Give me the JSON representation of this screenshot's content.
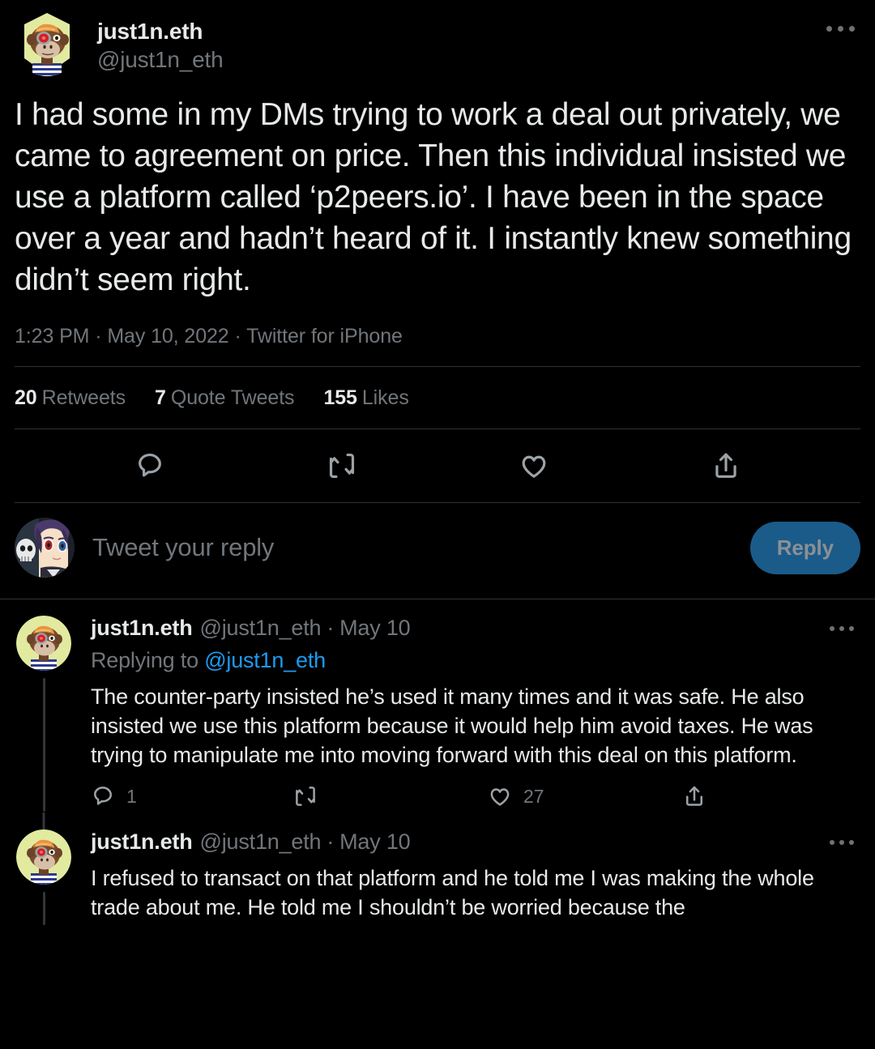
{
  "main_tweet": {
    "display_name": "just1n.eth",
    "handle": "@just1n_eth",
    "body": "I had some in my DMs trying to work a deal out privately, we came to agreement on price. Then this individual insisted we use a platform called ‘p2peers.io’. I have been in the space over a year and hadn’t heard of it. I instantly knew something didn’t seem right.",
    "time": "1:23 PM",
    "date": "May 10, 2022",
    "source": "Twitter for iPhone",
    "meta_line": "1:23 PM · May 10, 2022 · Twitter for iPhone",
    "more_label": "More",
    "stats": [
      {
        "count": "20",
        "label": "Retweets"
      },
      {
        "count": "7",
        "label": "Quote Tweets"
      },
      {
        "count": "155",
        "label": "Likes"
      }
    ],
    "actions": [
      {
        "icon": "reply-icon",
        "label": "Reply"
      },
      {
        "icon": "retweet-icon",
        "label": "Retweet"
      },
      {
        "icon": "like-icon",
        "label": "Like"
      },
      {
        "icon": "share-icon",
        "label": "Share"
      }
    ]
  },
  "composer": {
    "placeholder": "Tweet your reply",
    "button_label": "Reply",
    "button_color": "#1a5b8a",
    "button_text_color": "#8c9095"
  },
  "replies": [
    {
      "display_name": "just1n.eth",
      "handle": "@just1n_eth",
      "separator": "·",
      "date": "May 10",
      "replying_to_prefix": "Replying to ",
      "replying_to_handle": "@just1n_eth",
      "body": "The counter-party insisted he’s used it many times and it was safe. He also insisted we use this platform because it would help him avoid taxes. He was trying to manipulate me into moving forward with this deal on this platform.",
      "actions": [
        {
          "icon": "reply-icon",
          "count": "1"
        },
        {
          "icon": "retweet-icon",
          "count": ""
        },
        {
          "icon": "like-icon",
          "count": "27"
        },
        {
          "icon": "share-icon",
          "count": ""
        }
      ],
      "has_replying_to": true,
      "more_label": "More"
    },
    {
      "display_name": "just1n.eth",
      "handle": "@just1n_eth",
      "separator": "·",
      "date": "May 10",
      "body": "I refused to transact on that platform and he told me I was making the whole trade about me. He told me I shouldn’t be worried because the",
      "has_replying_to": false,
      "more_label": "More"
    }
  ],
  "theme": {
    "background": "#000000",
    "text_primary": "#e7e9ea",
    "text_secondary": "#71767b",
    "link": "#1d9bf0",
    "divider": "#2f3336",
    "thread_line": "#333639"
  },
  "avatars": {
    "author": "bored-ape-avatar",
    "viewer": "anime-character-avatar"
  }
}
